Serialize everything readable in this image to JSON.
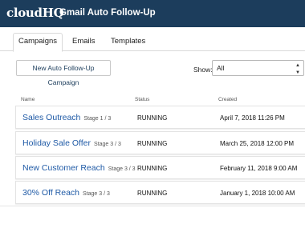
{
  "header": {
    "logo": "cloudHQ",
    "title": "Gmail Auto Follow-Up"
  },
  "tabs": [
    {
      "label": "Campaigns",
      "active": true
    },
    {
      "label": "Emails",
      "active": false
    },
    {
      "label": "Templates",
      "active": false
    }
  ],
  "toolbar": {
    "new_campaign_label": "New Auto Follow-Up Campaign",
    "show_label": "Show:",
    "show_value": "All"
  },
  "table": {
    "columns": [
      "Name",
      "Status",
      "Created"
    ],
    "rows": [
      {
        "name": "Sales Outreach",
        "stage": "Stage 1 / 3",
        "status": "RUNNING",
        "created": "April 7, 2018 11:26 PM"
      },
      {
        "name": "Holiday Sale Offer",
        "stage": "Stage 3 / 3",
        "status": "RUNNING",
        "created": "March 25, 2018 12:00 PM"
      },
      {
        "name": "New Customer Reach",
        "stage": "Stage 3 / 3",
        "status": "RUNNING",
        "created": "February 11, 2018 9:00 AM"
      },
      {
        "name": "30% Off Reach",
        "stage": "Stage 3 / 3",
        "status": "RUNNING",
        "created": "January 1, 2018 10:00 AM"
      }
    ]
  },
  "colors": {
    "header_bg": "#1c3d5c",
    "link": "#1f5aa6"
  }
}
